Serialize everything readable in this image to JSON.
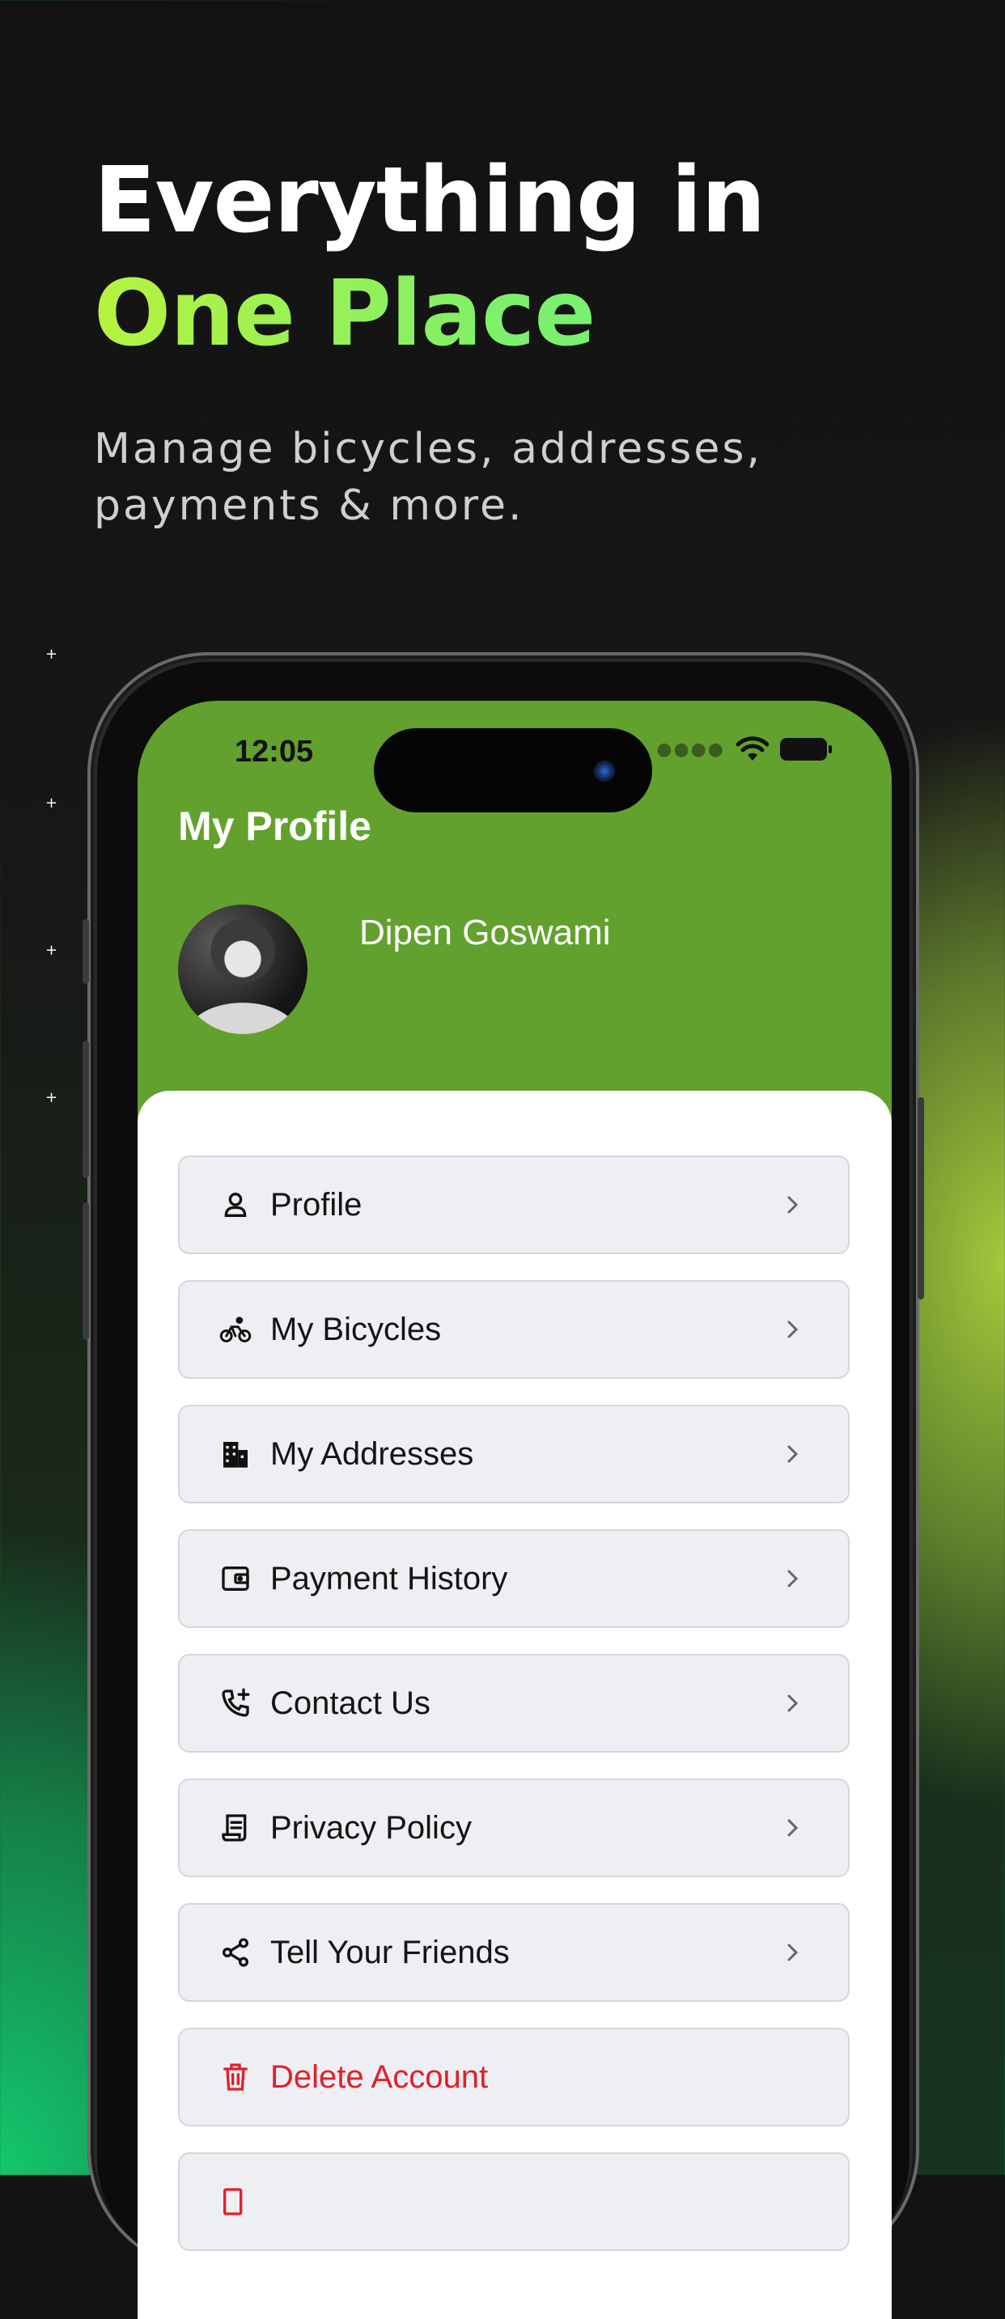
{
  "hero": {
    "title_line1": "Everything in",
    "title_line2": "One Place",
    "subtitle": "Manage bicycles, addresses, payments & more."
  },
  "status_bar": {
    "time": "12:05"
  },
  "screen": {
    "title": "My Profile",
    "user_name": "Dipen Goswami",
    "header_color": "#63a12e"
  },
  "menu": [
    {
      "label": "Profile",
      "icon": "person-icon"
    },
    {
      "label": "My Bicycles",
      "icon": "bicycle-icon"
    },
    {
      "label": "My Addresses",
      "icon": "building-icon"
    },
    {
      "label": "Payment History",
      "icon": "wallet-icon"
    },
    {
      "label": "Contact Us",
      "icon": "phone-add-icon"
    },
    {
      "label": "Privacy Policy",
      "icon": "document-icon"
    },
    {
      "label": "Tell Your Friends",
      "icon": "share-icon"
    },
    {
      "label": "Delete Account",
      "icon": "trash-icon",
      "danger": true
    }
  ],
  "colors": {
    "accent_green": "#7ef06a",
    "danger": "#e0202a"
  }
}
